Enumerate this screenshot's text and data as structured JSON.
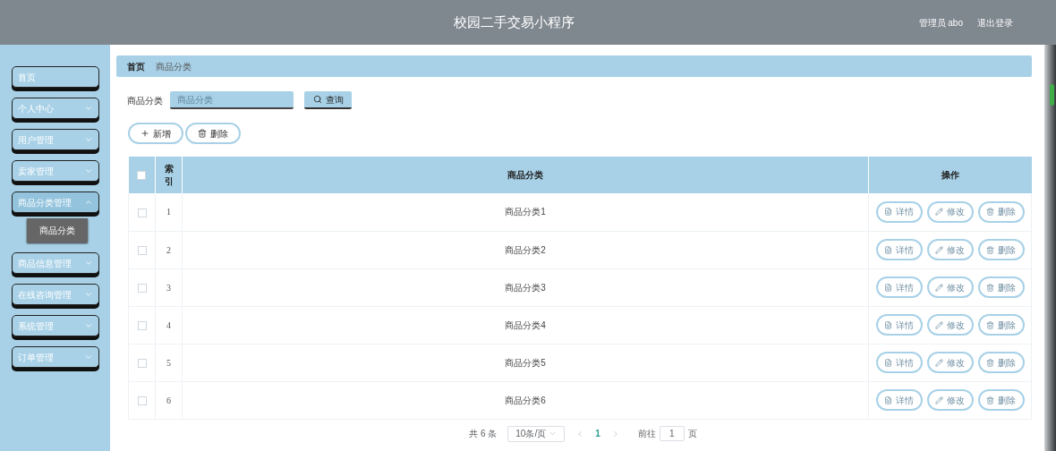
{
  "header": {
    "title": "校园二手交易小程序",
    "user": "管理员 abo",
    "logout": "退出登录"
  },
  "sidebar": {
    "items": [
      {
        "label": "首页",
        "kind": "link",
        "expanded": false
      },
      {
        "label": "个人中心",
        "kind": "group",
        "expanded": false
      },
      {
        "label": "用户管理",
        "kind": "group",
        "expanded": false
      },
      {
        "label": "卖家管理",
        "kind": "group",
        "expanded": false
      },
      {
        "label": "商品分类管理",
        "kind": "group",
        "expanded": true,
        "children": [
          {
            "label": "商品分类",
            "selected": true
          }
        ]
      },
      {
        "label": "商品信息管理",
        "kind": "group",
        "expanded": false
      },
      {
        "label": "在线咨询管理",
        "kind": "group",
        "expanded": false
      },
      {
        "label": "系统管理",
        "kind": "group",
        "expanded": false
      },
      {
        "label": "订单管理",
        "kind": "group",
        "expanded": false
      }
    ]
  },
  "breadcrumb": [
    "首页",
    "商品分类"
  ],
  "search": {
    "label": "商品分类",
    "placeholder": "商品分类",
    "button": "查询"
  },
  "actions": [
    "新增",
    "删除"
  ],
  "table": {
    "all_checked": false,
    "columns": [
      "索引",
      "商品分类",
      "操作"
    ],
    "rows": [
      {
        "checked": false,
        "index": "1",
        "name": "商品分类1",
        "actions": [
          "详情",
          "修改",
          "删除"
        ]
      },
      {
        "checked": false,
        "index": "2",
        "name": "商品分类2",
        "actions": [
          "详情",
          "修改",
          "删除"
        ]
      },
      {
        "checked": false,
        "index": "3",
        "name": "商品分类3",
        "actions": [
          "详情",
          "修改",
          "删除"
        ]
      },
      {
        "checked": false,
        "index": "4",
        "name": "商品分类4",
        "actions": [
          "详情",
          "修改",
          "删除"
        ]
      },
      {
        "checked": false,
        "index": "5",
        "name": "商品分类5",
        "actions": [
          "详情",
          "修改",
          "删除"
        ]
      },
      {
        "checked": false,
        "index": "6",
        "name": "商品分类6",
        "actions": [
          "详情",
          "修改",
          "删除"
        ]
      }
    ]
  },
  "pagination": {
    "total": "共 6 条",
    "page_size": "10条/页",
    "pages": [
      {
        "label": "1",
        "selected": true
      }
    ],
    "goto_label": "前往",
    "goto_value": "1",
    "goto_suffix": "页"
  }
}
